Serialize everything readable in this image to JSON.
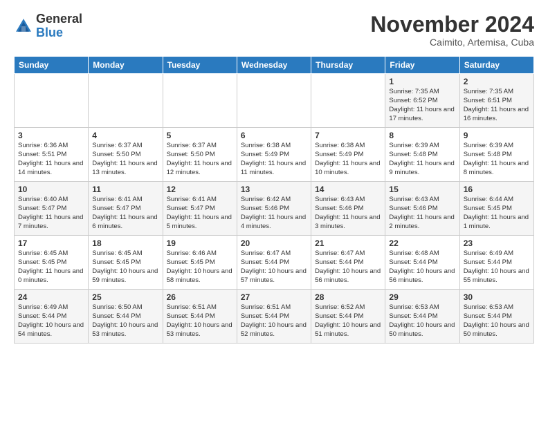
{
  "header": {
    "logo_general": "General",
    "logo_blue": "Blue",
    "month_title": "November 2024",
    "location": "Caimito, Artemisa, Cuba"
  },
  "weekdays": [
    "Sunday",
    "Monday",
    "Tuesday",
    "Wednesday",
    "Thursday",
    "Friday",
    "Saturday"
  ],
  "weeks": [
    [
      {
        "day": "",
        "info": ""
      },
      {
        "day": "",
        "info": ""
      },
      {
        "day": "",
        "info": ""
      },
      {
        "day": "",
        "info": ""
      },
      {
        "day": "",
        "info": ""
      },
      {
        "day": "1",
        "info": "Sunrise: 7:35 AM\nSunset: 6:52 PM\nDaylight: 11 hours and 17 minutes."
      },
      {
        "day": "2",
        "info": "Sunrise: 7:35 AM\nSunset: 6:51 PM\nDaylight: 11 hours and 16 minutes."
      }
    ],
    [
      {
        "day": "3",
        "info": "Sunrise: 6:36 AM\nSunset: 5:51 PM\nDaylight: 11 hours and 14 minutes."
      },
      {
        "day": "4",
        "info": "Sunrise: 6:37 AM\nSunset: 5:50 PM\nDaylight: 11 hours and 13 minutes."
      },
      {
        "day": "5",
        "info": "Sunrise: 6:37 AM\nSunset: 5:50 PM\nDaylight: 11 hours and 12 minutes."
      },
      {
        "day": "6",
        "info": "Sunrise: 6:38 AM\nSunset: 5:49 PM\nDaylight: 11 hours and 11 minutes."
      },
      {
        "day": "7",
        "info": "Sunrise: 6:38 AM\nSunset: 5:49 PM\nDaylight: 11 hours and 10 minutes."
      },
      {
        "day": "8",
        "info": "Sunrise: 6:39 AM\nSunset: 5:48 PM\nDaylight: 11 hours and 9 minutes."
      },
      {
        "day": "9",
        "info": "Sunrise: 6:39 AM\nSunset: 5:48 PM\nDaylight: 11 hours and 8 minutes."
      }
    ],
    [
      {
        "day": "10",
        "info": "Sunrise: 6:40 AM\nSunset: 5:47 PM\nDaylight: 11 hours and 7 minutes."
      },
      {
        "day": "11",
        "info": "Sunrise: 6:41 AM\nSunset: 5:47 PM\nDaylight: 11 hours and 6 minutes."
      },
      {
        "day": "12",
        "info": "Sunrise: 6:41 AM\nSunset: 5:47 PM\nDaylight: 11 hours and 5 minutes."
      },
      {
        "day": "13",
        "info": "Sunrise: 6:42 AM\nSunset: 5:46 PM\nDaylight: 11 hours and 4 minutes."
      },
      {
        "day": "14",
        "info": "Sunrise: 6:43 AM\nSunset: 5:46 PM\nDaylight: 11 hours and 3 minutes."
      },
      {
        "day": "15",
        "info": "Sunrise: 6:43 AM\nSunset: 5:46 PM\nDaylight: 11 hours and 2 minutes."
      },
      {
        "day": "16",
        "info": "Sunrise: 6:44 AM\nSunset: 5:45 PM\nDaylight: 11 hours and 1 minute."
      }
    ],
    [
      {
        "day": "17",
        "info": "Sunrise: 6:45 AM\nSunset: 5:45 PM\nDaylight: 11 hours and 0 minutes."
      },
      {
        "day": "18",
        "info": "Sunrise: 6:45 AM\nSunset: 5:45 PM\nDaylight: 10 hours and 59 minutes."
      },
      {
        "day": "19",
        "info": "Sunrise: 6:46 AM\nSunset: 5:45 PM\nDaylight: 10 hours and 58 minutes."
      },
      {
        "day": "20",
        "info": "Sunrise: 6:47 AM\nSunset: 5:44 PM\nDaylight: 10 hours and 57 minutes."
      },
      {
        "day": "21",
        "info": "Sunrise: 6:47 AM\nSunset: 5:44 PM\nDaylight: 10 hours and 56 minutes."
      },
      {
        "day": "22",
        "info": "Sunrise: 6:48 AM\nSunset: 5:44 PM\nDaylight: 10 hours and 56 minutes."
      },
      {
        "day": "23",
        "info": "Sunrise: 6:49 AM\nSunset: 5:44 PM\nDaylight: 10 hours and 55 minutes."
      }
    ],
    [
      {
        "day": "24",
        "info": "Sunrise: 6:49 AM\nSunset: 5:44 PM\nDaylight: 10 hours and 54 minutes."
      },
      {
        "day": "25",
        "info": "Sunrise: 6:50 AM\nSunset: 5:44 PM\nDaylight: 10 hours and 53 minutes."
      },
      {
        "day": "26",
        "info": "Sunrise: 6:51 AM\nSunset: 5:44 PM\nDaylight: 10 hours and 53 minutes."
      },
      {
        "day": "27",
        "info": "Sunrise: 6:51 AM\nSunset: 5:44 PM\nDaylight: 10 hours and 52 minutes."
      },
      {
        "day": "28",
        "info": "Sunrise: 6:52 AM\nSunset: 5:44 PM\nDaylight: 10 hours and 51 minutes."
      },
      {
        "day": "29",
        "info": "Sunrise: 6:53 AM\nSunset: 5:44 PM\nDaylight: 10 hours and 50 minutes."
      },
      {
        "day": "30",
        "info": "Sunrise: 6:53 AM\nSunset: 5:44 PM\nDaylight: 10 hours and 50 minutes."
      }
    ]
  ]
}
